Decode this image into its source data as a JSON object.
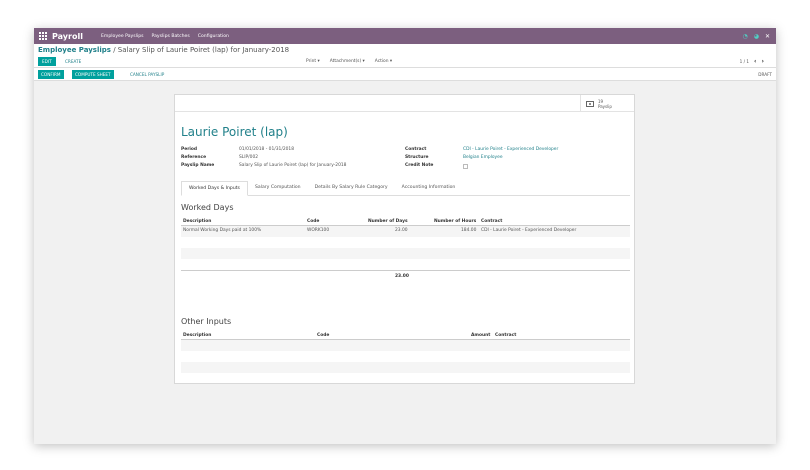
{
  "topbar": {
    "app_title": "Payroll",
    "menu": [
      "Employee Payslips",
      "Payslips Batches",
      "Configuration"
    ]
  },
  "breadcrumb": {
    "parent": "Employee Payslips",
    "separator": "/",
    "current": "Salary Slip of Laurie Poiret (lap) for January-2018"
  },
  "toolbar": {
    "edit_label": "EDIT",
    "create_label": "CREATE",
    "print_label": "Print ▾",
    "attachments_label": "Attachment(s) ▾",
    "action_label": "Action ▾",
    "pager": "1 / 1"
  },
  "statusbar": {
    "confirm_label": "CONFIRM",
    "compute_label": "COMPUTE SHEET",
    "cancel_label": "CANCEL PAYSLIP",
    "state": "DRAFT"
  },
  "smart_button": {
    "count": "19",
    "label": "Payslip"
  },
  "form": {
    "employee_name": "Laurie Poiret (lap)",
    "period_label": "Period",
    "period_value": "01/01/2018 - 01/31/2018",
    "reference_label": "Reference",
    "reference_value": "SLIP/002",
    "payslip_name_label": "Payslip Name",
    "payslip_name_value": "Salary Slip of Laurie Poiret (lap) for January-2018",
    "contract_label": "Contract",
    "contract_value": "CDI - Laurie Poiret - Experienced Developer",
    "structure_label": "Structure",
    "structure_value": "Belgian Employee",
    "credit_note_label": "Credit Note"
  },
  "tabs": [
    "Worked Days & Inputs",
    "Salary Computation",
    "Details By Salary Rule Category",
    "Accounting Information"
  ],
  "worked_days": {
    "title": "Worked Days",
    "headers": {
      "description": "Description",
      "code": "Code",
      "days": "Number of Days",
      "hours": "Number of Hours",
      "contract": "Contract"
    },
    "row": {
      "description": "Normal Working Days paid at 100%",
      "code": "WORK100",
      "days": "23.00",
      "hours": "184.00",
      "contract": "CDI - Laurie Poiret - Experienced Developer"
    },
    "total_days": "23.00"
  },
  "other_inputs": {
    "title": "Other Inputs",
    "headers": {
      "description": "Description",
      "code": "Code",
      "amount": "Amount",
      "contract": "Contract"
    }
  }
}
